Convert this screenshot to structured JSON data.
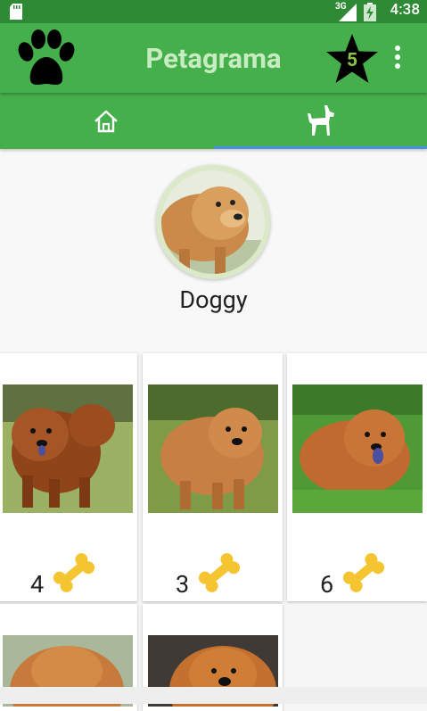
{
  "status_bar": {
    "network": "3G",
    "time": "4:38"
  },
  "app_bar": {
    "title": "Petagrama",
    "favorites_count": "5",
    "logo_icon": "paw-icon",
    "menu_icon": "more-vert-icon"
  },
  "tabs": [
    {
      "icon": "home-icon",
      "selected": false
    },
    {
      "icon": "dog-icon",
      "selected": true
    }
  ],
  "profile": {
    "name": "Doggy"
  },
  "photos": [
    {
      "likes": "4"
    },
    {
      "likes": "3"
    },
    {
      "likes": "6"
    },
    {
      "likes": ""
    },
    {
      "likes": ""
    }
  ],
  "colors": {
    "status_bar": "#2f8a36",
    "app_bar": "#45b04b",
    "title_text": "#c8ecc2",
    "tab_indicator": "#4a90e2",
    "bone": "#f5c431"
  }
}
